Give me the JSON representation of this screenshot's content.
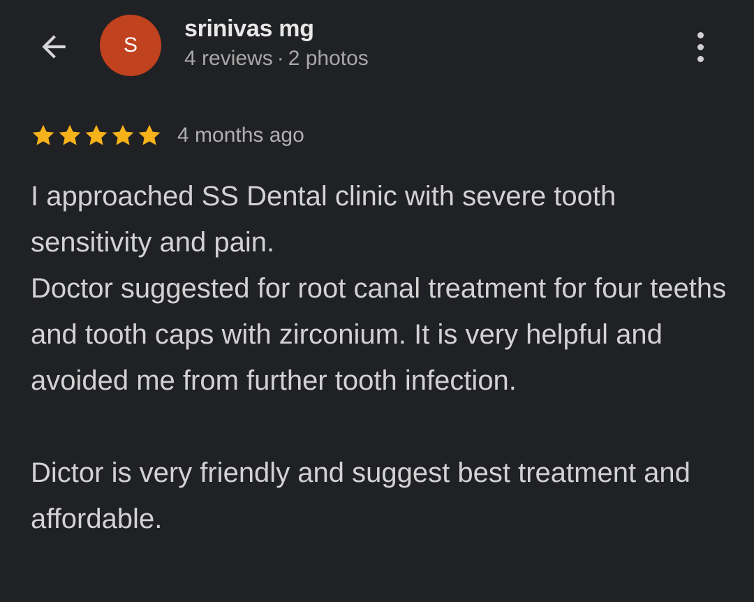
{
  "header": {
    "avatar_letter": "S",
    "user_name": "srinivas mg",
    "reviews_count": "4 reviews",
    "separator": "·",
    "photos_count": "2 photos"
  },
  "review": {
    "rating": 5,
    "time_ago": "4 months ago",
    "paragraphs": [
      "I approached SS Dental clinic with severe tooth sensitivity and pain.",
      "Doctor suggested for root canal treatment for four teeths and tooth caps with zirconium. It is very helpful and avoided me from further tooth infection.",
      "Dictor is very friendly and suggest best treatment and affordable."
    ]
  },
  "colors": {
    "background": "#202124",
    "avatar": "#c1421f",
    "star": "#f6b21b"
  },
  "icons": {
    "back": "arrow-left-icon",
    "more": "more-vertical-icon",
    "star": "star-icon"
  }
}
